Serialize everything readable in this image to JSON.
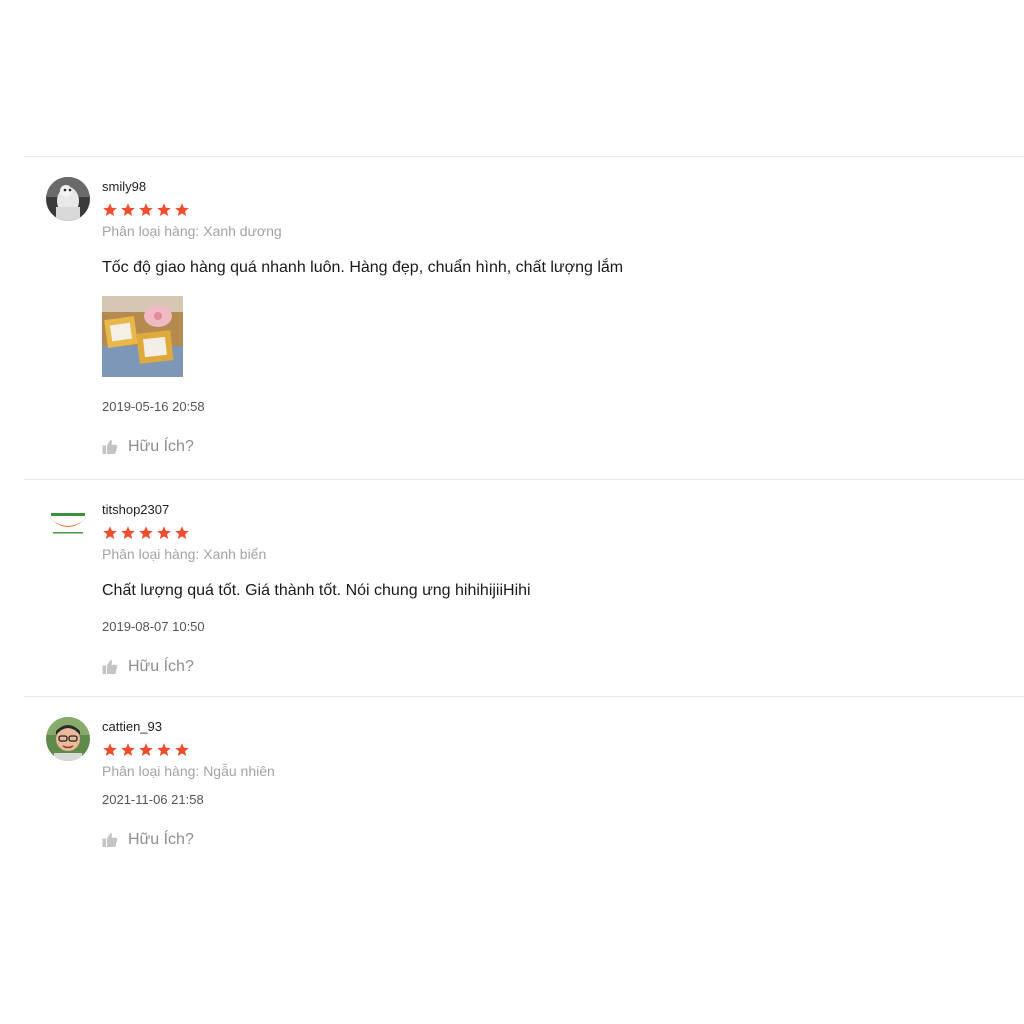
{
  "colors": {
    "star": "#ee4d2d",
    "muted": "#a3a3a3",
    "divider": "#e5e5e5"
  },
  "reviews": [
    {
      "username": "smily98",
      "rating": 5,
      "variation": "Phân loại hàng: Xanh dương",
      "comment": "Tốc độ giao hàng quá nhanh luôn. Hàng đẹp, chuẩn hình, chất lượng lắm",
      "time": "2019-05-16 20:58",
      "helpful_label": "Hữu Ích?",
      "avatar_icon": "avatar-photo-icon",
      "has_photo": true
    },
    {
      "username": "titshop2307",
      "rating": 5,
      "variation": "Phân loại hàng: Xanh biển",
      "comment": "Chất lượng quá tốt. Giá thành tốt. Nói chung ưng hihihijiiHihi",
      "time": "2019-08-07 10:50",
      "helpful_label": "Hữu Ích?",
      "avatar_icon": "avatar-logo-icon",
      "has_photo": false
    },
    {
      "username": "cattien_93",
      "rating": 5,
      "variation": "Phân loại hàng: Ngẫu nhiên",
      "comment": "",
      "time": "2021-11-06 21:58",
      "helpful_label": "Hữu Ích?",
      "avatar_icon": "avatar-photo-icon",
      "has_photo": false
    }
  ]
}
